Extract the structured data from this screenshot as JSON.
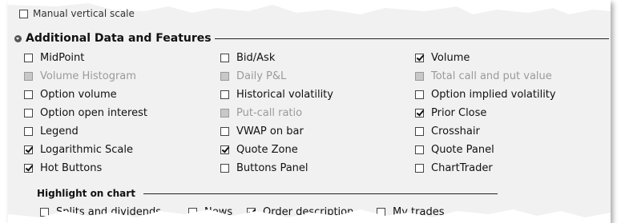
{
  "top_row": {
    "label": "Manual vertical scale"
  },
  "section": {
    "title": "Additional Data and Features"
  },
  "features": [
    {
      "label": "MidPoint",
      "checked": false,
      "disabled": false
    },
    {
      "label": "Bid/Ask",
      "checked": false,
      "disabled": false
    },
    {
      "label": "Volume",
      "checked": true,
      "disabled": false
    },
    {
      "label": "Volume Histogram",
      "checked": false,
      "disabled": true
    },
    {
      "label": "Daily P&L",
      "checked": false,
      "disabled": true
    },
    {
      "label": "Total call and put value",
      "checked": false,
      "disabled": true
    },
    {
      "label": "Option volume",
      "checked": false,
      "disabled": false
    },
    {
      "label": "Historical volatility",
      "checked": false,
      "disabled": false
    },
    {
      "label": "Option implied volatility",
      "checked": false,
      "disabled": false
    },
    {
      "label": "Option open interest",
      "checked": false,
      "disabled": false
    },
    {
      "label": "Put-call ratio",
      "checked": false,
      "disabled": true
    },
    {
      "label": "Prior Close",
      "checked": true,
      "disabled": false
    },
    {
      "label": "Legend",
      "checked": false,
      "disabled": false
    },
    {
      "label": "VWAP on bar",
      "checked": false,
      "disabled": false
    },
    {
      "label": "Crosshair",
      "checked": false,
      "disabled": false
    },
    {
      "label": "Logarithmic Scale",
      "checked": true,
      "disabled": false
    },
    {
      "label": "Quote Zone",
      "checked": true,
      "disabled": false
    },
    {
      "label": "Quote Panel",
      "checked": false,
      "disabled": false
    },
    {
      "label": "Hot Buttons",
      "checked": true,
      "disabled": false
    },
    {
      "label": "Buttons Panel",
      "checked": false,
      "disabled": false
    },
    {
      "label": "ChartTrader",
      "checked": false,
      "disabled": false
    }
  ],
  "highlight": {
    "title": "Highlight on chart",
    "items": [
      {
        "label": "Splits and dividends",
        "checked": false
      },
      {
        "label": "News",
        "checked": false
      },
      {
        "label": "Order description",
        "checked": true
      },
      {
        "label": "My trades",
        "checked": false
      }
    ]
  },
  "colors": {
    "panel_bg": "#f1f1f1",
    "disabled_text": "#9a9a9a",
    "disabled_box": "#c8c8c8"
  }
}
